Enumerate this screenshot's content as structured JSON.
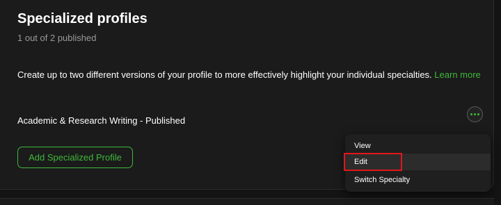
{
  "section": {
    "title": "Specialized profiles",
    "subtitle": "1 out of 2 published",
    "description": "Create up to two different versions of your profile to more effectively highlight your individual specialties.",
    "learn_more": "Learn more"
  },
  "profile": {
    "name": "Academic & Research Writing - Published",
    "more_icon": "more-horizontal-icon"
  },
  "actions": {
    "add_label": "Add Specialized Profile"
  },
  "menu": {
    "items": [
      "View",
      "Edit",
      "Switch Specialty"
    ],
    "highlighted": "Edit"
  },
  "colors": {
    "accent": "#3fb83a",
    "background": "#1b1b1b",
    "highlight": "#e2161b"
  }
}
